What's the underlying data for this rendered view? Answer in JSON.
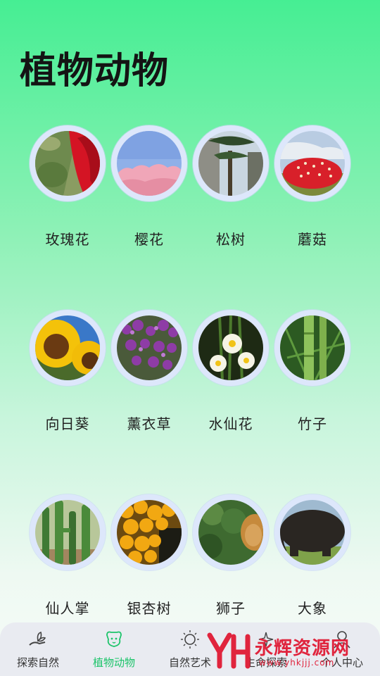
{
  "header": {
    "title": "植物动物"
  },
  "items": [
    {
      "label": "玫瑰花",
      "image": "rose-photo"
    },
    {
      "label": "樱花",
      "image": "cherry-blossom-photo"
    },
    {
      "label": "松树",
      "image": "pine-tree-photo"
    },
    {
      "label": "蘑菇",
      "image": "mushroom-photo"
    },
    {
      "label": "向日葵",
      "image": "sunflower-photo"
    },
    {
      "label": "薰衣草",
      "image": "lavender-photo"
    },
    {
      "label": "水仙花",
      "image": "narcissus-photo"
    },
    {
      "label": "竹子",
      "image": "bamboo-photo"
    },
    {
      "label": "仙人掌",
      "image": "cactus-photo"
    },
    {
      "label": "银杏树",
      "image": "ginkgo-photo"
    },
    {
      "label": "狮子",
      "image": "lion-photo"
    },
    {
      "label": "大象",
      "image": "elephant-photo"
    }
  ],
  "nav": [
    {
      "label": "探索自然",
      "icon": "hand-plant-icon",
      "active": false
    },
    {
      "label": "植物动物",
      "icon": "dog-icon",
      "active": true
    },
    {
      "label": "自然艺术",
      "icon": "sun-icon",
      "active": false
    },
    {
      "label": "生命探索",
      "icon": "sparkle-icon",
      "active": false
    },
    {
      "label": "个人中心",
      "icon": "user-icon",
      "active": false
    }
  ],
  "watermark": {
    "text": "永辉资源网",
    "url": "www.yhkjjj.com",
    "logo": "YH"
  },
  "colors": {
    "accent": "#1cc46a",
    "ring": "#dde7fb",
    "watermark": "#e0243d"
  }
}
